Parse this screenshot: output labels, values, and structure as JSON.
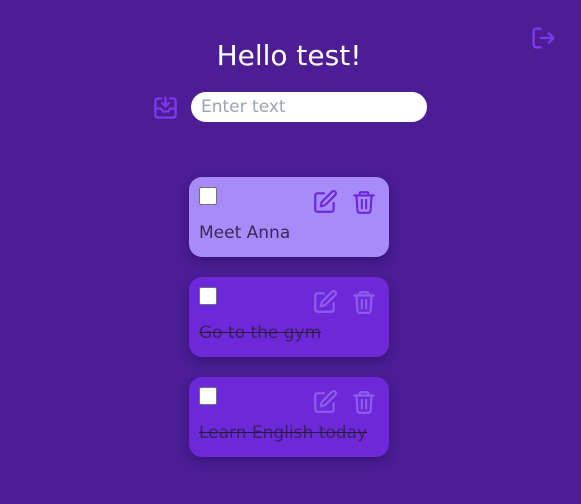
{
  "header": {
    "title": "Hello test!",
    "logout_icon": "logout-icon"
  },
  "input": {
    "placeholder": "Enter text",
    "value": "",
    "save_icon": "download-tray-icon"
  },
  "todos": [
    {
      "text": "Meet Anna",
      "completed": false,
      "checked": false,
      "card_color": "#a78bfa"
    },
    {
      "text": "Go to the gym",
      "completed": true,
      "checked": false,
      "card_color": "#6d28d9"
    },
    {
      "text": "Learn English today",
      "completed": true,
      "checked": false,
      "card_color": "#6d28d9"
    }
  ],
  "colors": {
    "background": "#4c1d95",
    "accent": "#7c3aed",
    "card_active": "#a78bfa",
    "card_done": "#6d28d9"
  }
}
